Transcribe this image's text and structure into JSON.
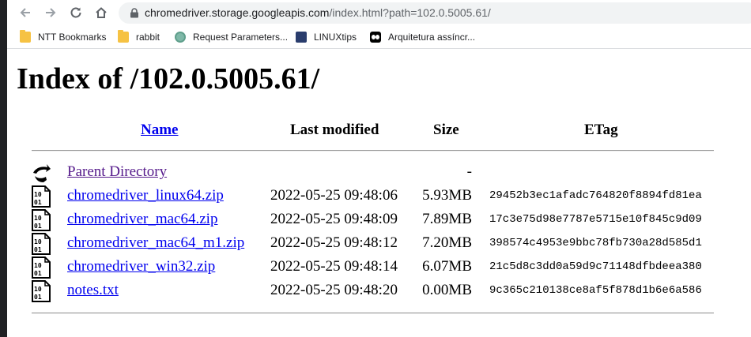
{
  "browser": {
    "url_host": "chromedriver.storage.googleapis.com",
    "url_path": "/index.html?path=102.0.5005.61/"
  },
  "bookmarks": [
    {
      "label": "NTT Bookmarks",
      "icon": "folder-icon"
    },
    {
      "label": "rabbit",
      "icon": "folder-icon"
    },
    {
      "label": "Request Parameters...",
      "icon": "site-favicon"
    },
    {
      "label": "LINUXtips",
      "icon": "linuxtips-favicon"
    },
    {
      "label": "Arquitetura assíncr...",
      "icon": "arquitetura-favicon"
    }
  ],
  "page": {
    "title": "Index of /102.0.5005.61/",
    "columns": {
      "name": "Name",
      "modified": "Last modified",
      "size": "Size",
      "etag": "ETag"
    },
    "rows": [
      {
        "name": "Parent Directory",
        "modified": "",
        "size": "-",
        "etag": "",
        "icon": "back-arrow-icon"
      },
      {
        "name": "chromedriver_linux64.zip",
        "modified": "2022-05-25 09:48:06",
        "size": "5.93MB",
        "etag": "29452b3ec1afadc764820f8894fd81ea",
        "icon": "binary-file-icon"
      },
      {
        "name": "chromedriver_mac64.zip",
        "modified": "2022-05-25 09:48:09",
        "size": "7.89MB",
        "etag": "17c3e75d98e7787e5715e10f845c9d09",
        "icon": "binary-file-icon"
      },
      {
        "name": "chromedriver_mac64_m1.zip",
        "modified": "2022-05-25 09:48:12",
        "size": "7.20MB",
        "etag": "398574c4953e9bbc78fb730a28d585d1",
        "icon": "binary-file-icon"
      },
      {
        "name": "chromedriver_win32.zip",
        "modified": "2022-05-25 09:48:14",
        "size": "6.07MB",
        "etag": "21c5d8c3dd0a59d9c71148dfbdeea380",
        "icon": "binary-file-icon"
      },
      {
        "name": "notes.txt",
        "modified": "2022-05-25 09:48:20",
        "size": "0.00MB",
        "etag": "9c365c210138ce8af5f878d1b6e6a586",
        "icon": "binary-file-icon"
      }
    ]
  },
  "colors": {
    "link": "#0000ee",
    "visited_link": "#551a8b",
    "omnibox": "#f1f3f4"
  }
}
